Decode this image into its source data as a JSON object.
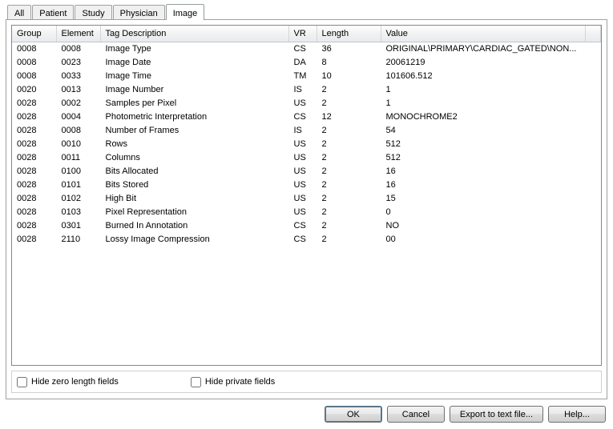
{
  "tabs": [
    "All",
    "Patient",
    "Study",
    "Physician",
    "Image"
  ],
  "activeTab": "Image",
  "columns": [
    "Group",
    "Element",
    "Tag Description",
    "VR",
    "Length",
    "Value"
  ],
  "rows": [
    {
      "group": "0008",
      "element": "0008",
      "desc": "Image Type",
      "vr": "CS",
      "length": "36",
      "value": "ORIGINAL\\PRIMARY\\CARDIAC_GATED\\NON..."
    },
    {
      "group": "0008",
      "element": "0023",
      "desc": "Image Date",
      "vr": "DA",
      "length": "8",
      "value": "20061219"
    },
    {
      "group": "0008",
      "element": "0033",
      "desc": "Image Time",
      "vr": "TM",
      "length": "10",
      "value": "101606.512"
    },
    {
      "group": "0020",
      "element": "0013",
      "desc": "Image Number",
      "vr": "IS",
      "length": "2",
      "value": "1"
    },
    {
      "group": "0028",
      "element": "0002",
      "desc": "Samples per Pixel",
      "vr": "US",
      "length": "2",
      "value": "1"
    },
    {
      "group": "0028",
      "element": "0004",
      "desc": "Photometric Interpretation",
      "vr": "CS",
      "length": "12",
      "value": "MONOCHROME2"
    },
    {
      "group": "0028",
      "element": "0008",
      "desc": "Number of Frames",
      "vr": "IS",
      "length": "2",
      "value": "54"
    },
    {
      "group": "0028",
      "element": "0010",
      "desc": "Rows",
      "vr": "US",
      "length": "2",
      "value": "512"
    },
    {
      "group": "0028",
      "element": "0011",
      "desc": "Columns",
      "vr": "US",
      "length": "2",
      "value": "512"
    },
    {
      "group": "0028",
      "element": "0100",
      "desc": "Bits Allocated",
      "vr": "US",
      "length": "2",
      "value": "16"
    },
    {
      "group": "0028",
      "element": "0101",
      "desc": "Bits Stored",
      "vr": "US",
      "length": "2",
      "value": "16"
    },
    {
      "group": "0028",
      "element": "0102",
      "desc": "High Bit",
      "vr": "US",
      "length": "2",
      "value": "15"
    },
    {
      "group": "0028",
      "element": "0103",
      "desc": "Pixel Representation",
      "vr": "US",
      "length": "2",
      "value": "0"
    },
    {
      "group": "0028",
      "element": "0301",
      "desc": "Burned In Annotation",
      "vr": "CS",
      "length": "2",
      "value": "NO"
    },
    {
      "group": "0028",
      "element": "2110",
      "desc": "Lossy Image Compression",
      "vr": "CS",
      "length": "2",
      "value": "00"
    }
  ],
  "options": {
    "hideZeroLabel": "Hide zero length fields",
    "hidePrivateLabel": "Hide private fields"
  },
  "buttons": {
    "ok": "OK",
    "cancel": "Cancel",
    "export": "Export to text file...",
    "help": "Help..."
  }
}
